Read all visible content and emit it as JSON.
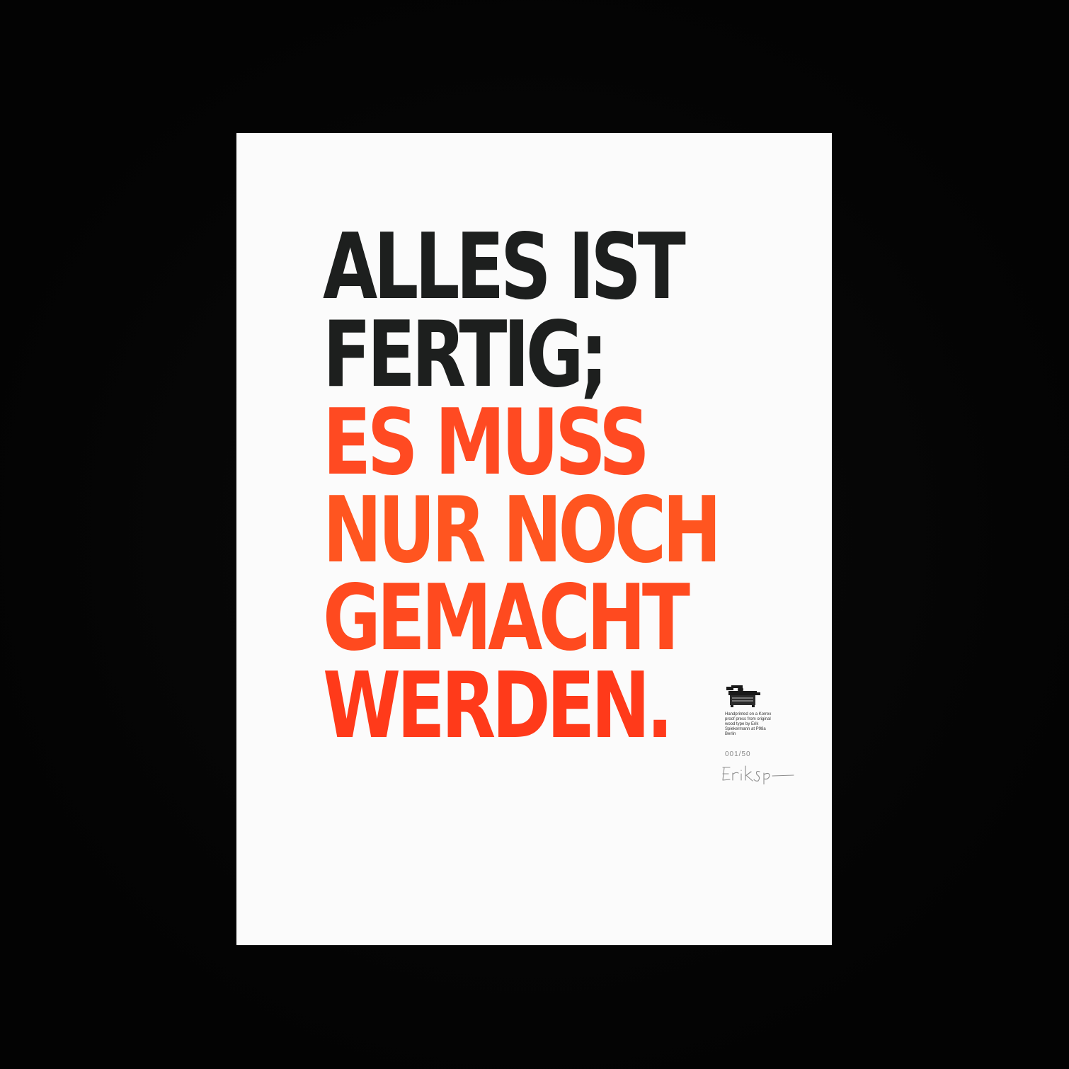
{
  "poster": {
    "headline_lines": [
      "ALLES IST",
      "FERTIG;",
      "ES MUSS",
      "NUR NOCH",
      "GEMACHT",
      "WERDEN."
    ],
    "colophon": "Handprinted on a Korrex proof press from original wood type by Erik Spiekermann at P98a Berlin",
    "edition": "001/50",
    "signature": "Erik Sp"
  },
  "colors": {
    "background": "#050505",
    "paper": "#fbfbfb",
    "black_ink": "#1d1f1e",
    "red_ink": "#ff3b1f"
  },
  "icons": [
    "proof-press-icon"
  ]
}
